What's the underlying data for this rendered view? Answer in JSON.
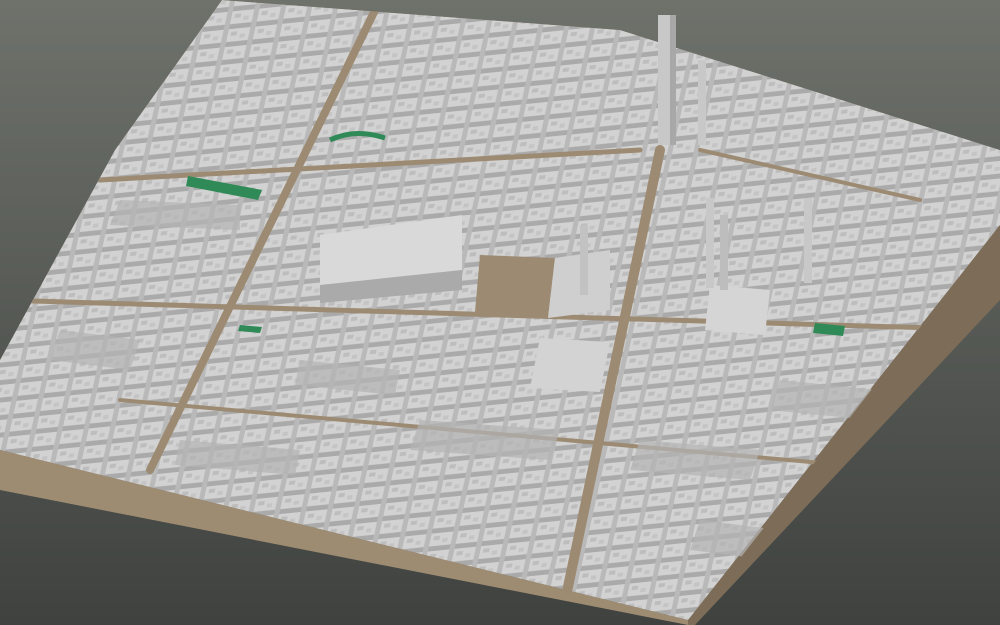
{
  "scene": {
    "kind": "3d-city-model",
    "view": "isometric-aerial",
    "colors": {
      "background_top": "#6e726b",
      "background_bottom": "#3f423f",
      "base_top": "#8b7b66",
      "base_side": "#9e8c72",
      "base_side_dark": "#7d6d58",
      "building_roof": "#d2d2d2",
      "building_wall_light": "#c2c2c2",
      "building_wall_dark": "#a9a9a9",
      "street": "#9c8b72",
      "park": "#2f8a57",
      "tower": "#c8c8c8"
    },
    "features": {
      "parks": [
        "park-north-west",
        "park-central-north",
        "park-east",
        "park-south-west"
      ],
      "towers": [
        "tall-tower-north",
        "tower-east-a",
        "tower-east-b",
        "tower-east-c"
      ],
      "plazas": [
        "central-plaza",
        "large-block-roof"
      ]
    }
  }
}
